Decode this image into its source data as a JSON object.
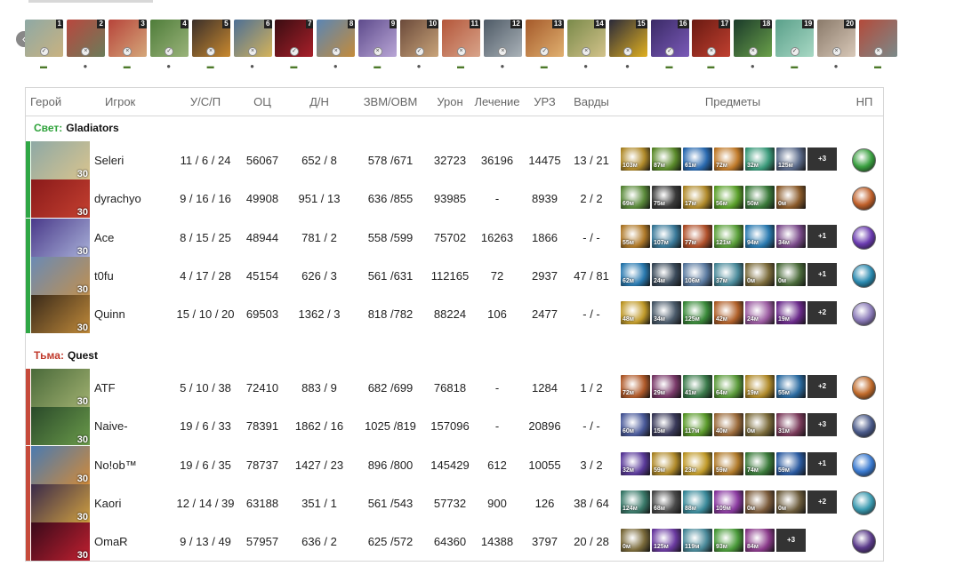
{
  "picks": [
    {
      "num": "1",
      "icon": "hero-portrait-icon",
      "c1": "#8ea9a5",
      "c2": "#c9b280",
      "side": "radiant"
    },
    {
      "num": "2",
      "icon": "hero-portrait-icon",
      "c1": "#b9473e",
      "c2": "#6b7c5a",
      "side": "dire"
    },
    {
      "num": "3",
      "icon": "hero-portrait-icon",
      "c1": "#b7443a",
      "c2": "#d4a77a",
      "side": "radiant"
    },
    {
      "num": "4",
      "icon": "hero-portrait-icon",
      "c1": "#4f7d3a",
      "c2": "#9ab37a",
      "side": "dire"
    },
    {
      "num": "5",
      "icon": "hero-portrait-icon",
      "c1": "#3a2f2a",
      "c2": "#c9892f",
      "side": "radiant"
    },
    {
      "num": "6",
      "icon": "hero-portrait-icon",
      "c1": "#4d6f95",
      "c2": "#d5b35a",
      "side": "dire"
    },
    {
      "num": "7",
      "icon": "hero-portrait-icon",
      "c1": "#3a0d12",
      "c2": "#a8202a",
      "side": "radiant"
    },
    {
      "num": "8",
      "icon": "hero-portrait-icon",
      "c1": "#5b86b4",
      "c2": "#c48b3a",
      "side": "dire"
    },
    {
      "num": "9",
      "icon": "hero-portrait-icon",
      "c1": "#5e4b8c",
      "c2": "#b9a6d6",
      "side": "radiant"
    },
    {
      "num": "10",
      "icon": "hero-portrait-icon",
      "c1": "#6b4a3a",
      "c2": "#c9a47a",
      "side": "dire"
    },
    {
      "num": "11",
      "icon": "hero-portrait-icon",
      "c1": "#b4563a",
      "c2": "#d8a48a",
      "side": "radiant"
    },
    {
      "num": "12",
      "icon": "hero-portrait-icon",
      "c1": "#4e5a66",
      "c2": "#aab2b8",
      "side": "dire"
    },
    {
      "num": "13",
      "icon": "hero-portrait-icon",
      "c1": "#a55a2a",
      "c2": "#e0b070",
      "side": "radiant"
    },
    {
      "num": "14",
      "icon": "hero-portrait-icon",
      "c1": "#7a8a4a",
      "c2": "#d2c28a",
      "side": "dire"
    },
    {
      "num": "15",
      "icon": "hero-portrait-icon",
      "c1": "#2a2a3a",
      "c2": "#e0b020",
      "side": "dire"
    },
    {
      "num": "16",
      "icon": "hero-portrait-icon",
      "c1": "#3a2a66",
      "c2": "#7a5ab8",
      "side": "radiant"
    },
    {
      "num": "17",
      "icon": "hero-portrait-icon",
      "c1": "#6a1a12",
      "c2": "#c04030",
      "side": "radiant"
    },
    {
      "num": "18",
      "icon": "hero-portrait-icon",
      "c1": "#1a3a2a",
      "c2": "#6aa04a",
      "side": "dire"
    },
    {
      "num": "19",
      "icon": "hero-portrait-icon",
      "c1": "#5aa08a",
      "c2": "#a8d8c4",
      "side": "radiant"
    },
    {
      "num": "20",
      "icon": "hero-portrait-icon",
      "c1": "#8a7a6a",
      "c2": "#d8c8b8",
      "side": "dire"
    },
    {
      "num": "",
      "icon": "hero-portrait-icon",
      "c1": "#b44a3a",
      "c2": "#7a8a8a",
      "side": "radiant"
    }
  ],
  "headers": {
    "hero": "Герой",
    "player": "Игрок",
    "kda": "У/С/П",
    "nw": "ОЦ",
    "lhdn": "Д/Н",
    "gpmxpm": "ЗВМ/ОВМ",
    "damage": "Урон",
    "heal": "Лечение",
    "bld": "УРЗ",
    "wards": "Варды",
    "items": "Предметы",
    "neutral": "НП"
  },
  "teams": [
    {
      "side_label": "Свет:",
      "name": "Gladiators",
      "side": "radiant",
      "players": [
        {
          "player": "Seleri",
          "level": "30",
          "kda": "11 / 6 / 24",
          "nw": "56067",
          "lhdn": "652 / 8",
          "gpmxpm": "578 /671",
          "damage": "32723",
          "heal": "36196",
          "bld": "14475",
          "wards": "13 / 21",
          "hero_colors": [
            "#8ea9a5",
            "#d9c48e"
          ],
          "neutral_color": "#3aa040",
          "items": [
            {
              "t": "103м",
              "c": "#b08a2a"
            },
            {
              "t": "87м",
              "c": "#5a8a2a"
            },
            {
              "t": "61м",
              "c": "#2a6ab0"
            },
            {
              "t": "72м",
              "c": "#c07a2a"
            },
            {
              "t": "32м",
              "c": "#3a9a7a"
            },
            {
              "t": "125м",
              "c": "#5a6a8a"
            }
          ],
          "more": "+3"
        },
        {
          "player": "dyrachyo",
          "level": "30",
          "kda": "9 / 16 / 16",
          "nw": "49908",
          "lhdn": "951 / 13",
          "gpmxpm": "636 /855",
          "damage": "93985",
          "heal": "-",
          "bld": "8939",
          "wards": "2 / 2",
          "hero_colors": [
            "#8a1a1a",
            "#c44030"
          ],
          "neutral_color": "#c0602a",
          "items": [
            {
              "t": "69м",
              "c": "#5a8a3a"
            },
            {
              "t": "75м",
              "c": "#3a3a3a"
            },
            {
              "t": "17м",
              "c": "#b08a2a"
            },
            {
              "t": "56м",
              "c": "#5aa02a"
            },
            {
              "t": "50м",
              "c": "#3a7a3a"
            },
            {
              "t": "0м",
              "c": "#8a5a2a"
            }
          ],
          "more": ""
        },
        {
          "player": "Ace",
          "level": "30",
          "kda": "8 / 15 / 25",
          "nw": "48944",
          "lhdn": "781 / 2",
          "gpmxpm": "558 /599",
          "damage": "75702",
          "heal": "16263",
          "bld": "1866",
          "wards": "- / -",
          "hero_colors": [
            "#4a3a8a",
            "#a8b0d8"
          ],
          "neutral_color": "#6a3ab0",
          "items": [
            {
              "t": "55м",
              "c": "#b07a2a"
            },
            {
              "t": "107м",
              "c": "#3a7a9a"
            },
            {
              "t": "77м",
              "c": "#b0502a"
            },
            {
              "t": "121м",
              "c": "#5aa03a"
            },
            {
              "t": "94м",
              "c": "#2a7ab0"
            },
            {
              "t": "34м",
              "c": "#7a4a8a"
            }
          ],
          "more": "+1"
        },
        {
          "player": "t0fu",
          "level": "30",
          "kda": "4 / 17 / 28",
          "nw": "45154",
          "lhdn": "626 / 3",
          "gpmxpm": "561 /631",
          "damage": "112165",
          "heal": "72",
          "bld": "2937",
          "wards": "47 / 81",
          "hero_colors": [
            "#6a8ab4",
            "#c09050"
          ],
          "neutral_color": "#2a8ab0",
          "items": [
            {
              "t": "62м",
              "c": "#2a7ab0"
            },
            {
              "t": "24м",
              "c": "#3a4a5a"
            },
            {
              "t": "106м",
              "c": "#5a7aa0"
            },
            {
              "t": "37м",
              "c": "#4a8a9a"
            },
            {
              "t": "0м",
              "c": "#7a6a3a"
            },
            {
              "t": "0м",
              "c": "#4a6a3a"
            }
          ],
          "more": "+1"
        },
        {
          "player": "Quinn",
          "level": "30",
          "kda": "15 / 10 / 20",
          "nw": "69503",
          "lhdn": "1362 / 3",
          "gpmxpm": "818 /782",
          "damage": "88224",
          "heal": "106",
          "bld": "2477",
          "wards": "- / -",
          "hero_colors": [
            "#3a2a1a",
            "#c08a3a"
          ],
          "neutral_color": "#8a7ab8",
          "items": [
            {
              "t": "48м",
              "c": "#c09a2a"
            },
            {
              "t": "34м",
              "c": "#4a5a6a"
            },
            {
              "t": "125м",
              "c": "#3a8a3a"
            },
            {
              "t": "42м",
              "c": "#b0602a"
            },
            {
              "t": "24м",
              "c": "#9a5aa0"
            },
            {
              "t": "19м",
              "c": "#6a2a8a"
            }
          ],
          "more": "+2"
        }
      ]
    },
    {
      "side_label": "Тьма:",
      "name": "Quest",
      "side": "dire",
      "players": [
        {
          "player": "ATF",
          "level": "30",
          "kda": "5 / 10 / 38",
          "nw": "72410",
          "lhdn": "883 / 9",
          "gpmxpm": "682 /699",
          "damage": "76818",
          "heal": "-",
          "bld": "1284",
          "wards": "1 / 2",
          "hero_colors": [
            "#4a6a3a",
            "#a0b070"
          ],
          "neutral_color": "#c06a2a",
          "items": [
            {
              "t": "72м",
              "c": "#b05a2a"
            },
            {
              "t": "29м",
              "c": "#7a3a6a"
            },
            {
              "t": "41м",
              "c": "#3a7a4a"
            },
            {
              "t": "64м",
              "c": "#5a9a3a"
            },
            {
              "t": "19м",
              "c": "#b08a2a"
            },
            {
              "t": "55м",
              "c": "#2a6aa0"
            }
          ],
          "more": "+2"
        },
        {
          "player": "Naive-",
          "level": "30",
          "kda": "19 / 6 / 33",
          "nw": "78391",
          "lhdn": "1862 / 16",
          "gpmxpm": "1025 /819",
          "damage": "157096",
          "heal": "-",
          "bld": "20896",
          "wards": "- / -",
          "hero_colors": [
            "#2a4a2a",
            "#6a9a4a"
          ],
          "neutral_color": "#4a5a8a",
          "items": [
            {
              "t": "60м",
              "c": "#4a5a9a"
            },
            {
              "t": "15м",
              "c": "#3a3a5a"
            },
            {
              "t": "117м",
              "c": "#5a9a2a"
            },
            {
              "t": "40м",
              "c": "#9a6a3a"
            },
            {
              "t": "0м",
              "c": "#7a6a3a"
            },
            {
              "t": "31м",
              "c": "#7a3a5a"
            }
          ],
          "more": "+3"
        },
        {
          "player": "No!ob™",
          "level": "30",
          "kda": "19 / 6 / 35",
          "nw": "78737",
          "lhdn": "1427 / 23",
          "gpmxpm": "896 /800",
          "damage": "145429",
          "heal": "612",
          "bld": "10055",
          "wards": "3 / 2",
          "hero_colors": [
            "#4a7ab0",
            "#d08a3a"
          ],
          "neutral_color": "#3a7ad0",
          "items": [
            {
              "t": "32м",
              "c": "#5a3a9a"
            },
            {
              "t": "59м",
              "c": "#b08a2a"
            },
            {
              "t": "23м",
              "c": "#c09a2a"
            },
            {
              "t": "59м",
              "c": "#b07a2a"
            },
            {
              "t": "74м",
              "c": "#3a7a3a"
            },
            {
              "t": "59м",
              "c": "#2a5aa0"
            }
          ],
          "more": "+1"
        },
        {
          "player": "Kaori",
          "level": "30",
          "kda": "12 / 14 / 39",
          "nw": "63188",
          "lhdn": "351 / 1",
          "gpmxpm": "561 /543",
          "damage": "57732",
          "heal": "900",
          "bld": "126",
          "wards": "38 / 64",
          "hero_colors": [
            "#3a2a4a",
            "#d0a040"
          ],
          "neutral_color": "#3a9ab0",
          "items": [
            {
              "t": "124м",
              "c": "#3a7a6a"
            },
            {
              "t": "68м",
              "c": "#4a4a4a"
            },
            {
              "t": "88м",
              "c": "#3a8a9a"
            },
            {
              "t": "109м",
              "c": "#8a3aa0"
            },
            {
              "t": "0м",
              "c": "#7a5a3a"
            },
            {
              "t": "0м",
              "c": "#6a5a3a"
            }
          ],
          "more": "+2"
        },
        {
          "player": "OmaR",
          "level": "30",
          "kda": "9 / 13 / 49",
          "nw": "57957",
          "lhdn": "636 / 2",
          "gpmxpm": "625 /572",
          "damage": "64360",
          "heal": "14388",
          "bld": "3797",
          "wards": "20 / 28",
          "hero_colors": [
            "#3a0a1a",
            "#c02030"
          ],
          "neutral_color": "#5a3a8a",
          "items": [
            {
              "t": "0м",
              "c": "#7a6a3a"
            },
            {
              "t": "125м",
              "c": "#6a3aa0"
            },
            {
              "t": "119м",
              "c": "#4a8a9a"
            },
            {
              "t": "93м",
              "c": "#4a9a3a"
            },
            {
              "t": "84м",
              "c": "#8a3a8a"
            }
          ],
          "more": "+3"
        }
      ]
    }
  ]
}
